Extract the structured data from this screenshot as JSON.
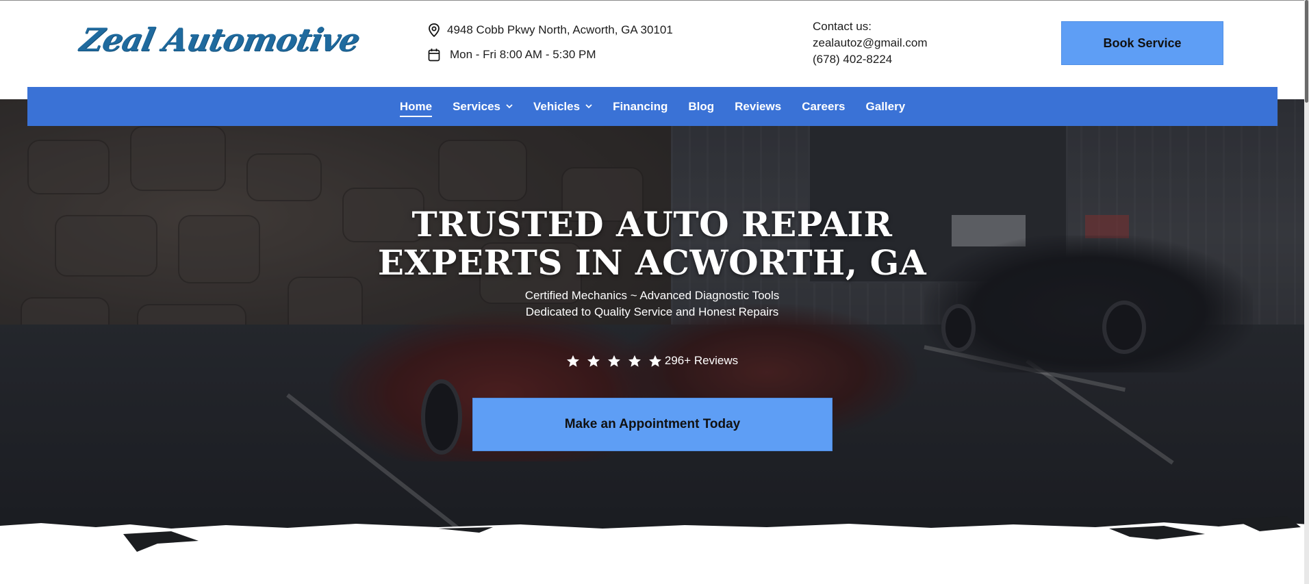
{
  "brand": {
    "logo_text": "Zeal Automotive",
    "accent": "#3a72d6",
    "button_color": "#5e9ef5",
    "logo_color": "#1f6a9e"
  },
  "header": {
    "address": "4948 Cobb Pkwy North, Acworth, GA 30101",
    "hours": "Mon - Fri 8:00 AM - 5:30 PM",
    "contact_label": "Contact us:",
    "email": "zealautoz@gmail.com",
    "phone": "(678) 402-8224",
    "book_button": "Book Service",
    "icons": {
      "address": "map-pin-icon",
      "hours": "calendar-icon"
    }
  },
  "nav": {
    "items": [
      {
        "label": "Home",
        "active": true,
        "dropdown": false
      },
      {
        "label": "Services",
        "active": false,
        "dropdown": true
      },
      {
        "label": "Vehicles",
        "active": false,
        "dropdown": true
      },
      {
        "label": "Financing",
        "active": false,
        "dropdown": false
      },
      {
        "label": "Blog",
        "active": false,
        "dropdown": false
      },
      {
        "label": "Reviews",
        "active": false,
        "dropdown": false
      },
      {
        "label": "Careers",
        "active": false,
        "dropdown": false
      },
      {
        "label": "Gallery",
        "active": false,
        "dropdown": false
      }
    ]
  },
  "hero": {
    "title_line1": "TRUSTED AUTO REPAIR",
    "title_line2": "EXPERTS IN ACWORTH, GA",
    "subtitle_line1": "Certified Mechanics ~ Advanced Diagnostic Tools",
    "subtitle_line2": "Dedicated to Quality Service and Honest Repairs",
    "rating_stars": 5,
    "reviews_text": "296+ Reviews",
    "cta_button": "Make an Appointment Today"
  }
}
